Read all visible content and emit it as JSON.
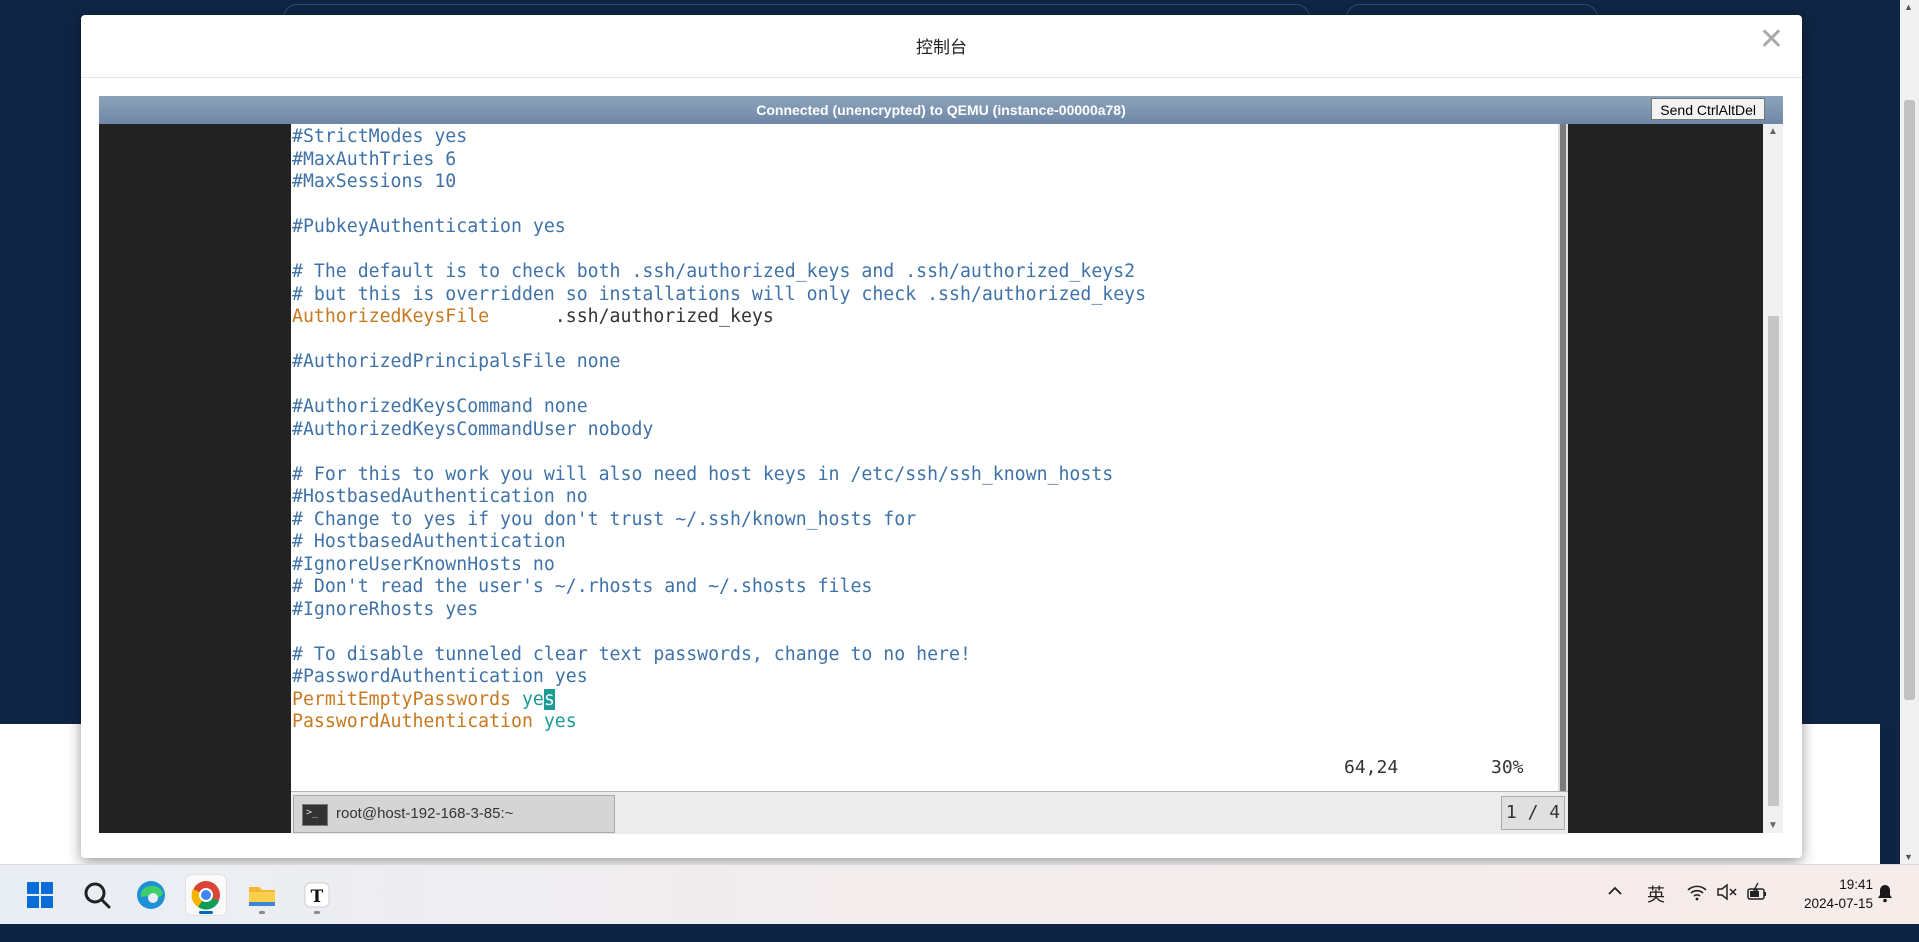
{
  "modal": {
    "title": "控制台",
    "close_glyph": "✕"
  },
  "vnc": {
    "status_text": "Connected (unencrypted) to QEMU (instance-00000a78)",
    "send_ctrl_alt_del_label": "Send CtrlAltDel"
  },
  "terminal": {
    "lines": [
      [
        {
          "t": "#StrictModes yes",
          "c": "comment"
        }
      ],
      [
        {
          "t": "#MaxAuthTries 6",
          "c": "comment"
        }
      ],
      [
        {
          "t": "#MaxSessions 10",
          "c": "comment"
        }
      ],
      [],
      [
        {
          "t": "#PubkeyAuthentication yes",
          "c": "comment"
        }
      ],
      [],
      [
        {
          "t": "# The default is to check both .ssh/authorized_keys and .ssh/authorized_keys2",
          "c": "comment"
        }
      ],
      [
        {
          "t": "# but this is overridden so installations will only check .ssh/authorized_keys",
          "c": "comment"
        }
      ],
      [
        {
          "t": "AuthorizedKeysFile",
          "c": "keyword"
        },
        {
          "t": "      .ssh/authorized_keys",
          "c": "plain"
        }
      ],
      [],
      [
        {
          "t": "#AuthorizedPrincipalsFile none",
          "c": "comment"
        }
      ],
      [],
      [
        {
          "t": "#AuthorizedKeysCommand none",
          "c": "comment"
        }
      ],
      [
        {
          "t": "#AuthorizedKeysCommandUser nobody",
          "c": "comment"
        }
      ],
      [],
      [
        {
          "t": "# For this to work you will also need host keys in /etc/ssh/ssh_known_hosts",
          "c": "comment"
        }
      ],
      [
        {
          "t": "#HostbasedAuthentication no",
          "c": "comment"
        }
      ],
      [
        {
          "t": "# Change to yes if you don't trust ~/.ssh/known_hosts for",
          "c": "comment"
        }
      ],
      [
        {
          "t": "# HostbasedAuthentication",
          "c": "comment"
        }
      ],
      [
        {
          "t": "#IgnoreUserKnownHosts no",
          "c": "comment"
        }
      ],
      [
        {
          "t": "# Don't read the user's ~/.rhosts and ~/.shosts files",
          "c": "comment"
        }
      ],
      [
        {
          "t": "#IgnoreRhosts yes",
          "c": "comment"
        }
      ],
      [],
      [
        {
          "t": "# To disable tunneled clear text passwords, change to no here!",
          "c": "comment"
        }
      ],
      [
        {
          "t": "#PasswordAuthentication yes",
          "c": "comment"
        }
      ],
      [
        {
          "t": "PermitEmptyPasswords",
          "c": "keyword"
        },
        {
          "t": " ye",
          "c": "value"
        },
        {
          "t": "s",
          "c": "cursor"
        }
      ],
      [
        {
          "t": "PasswordAuthentication",
          "c": "keyword"
        },
        {
          "t": " yes",
          "c": "value"
        }
      ]
    ],
    "cursor_position": "64,24",
    "scroll_percent": "30%"
  },
  "remote_taskbar": {
    "task_label": "root@host-192-168-3-85:~",
    "terminal_glyph": ">_",
    "pager": "1 / 4"
  },
  "host_taskbar": {
    "input_method": "英",
    "time": "19:41",
    "date": "2024-07-15",
    "app_icons": [
      "windows-start-icon",
      "search-icon",
      "edge-icon",
      "chrome-icon",
      "file-explorer-icon",
      "typora-icon"
    ]
  },
  "colors": {
    "comment": "#3e72a8",
    "keyword": "#c8781e",
    "value": "#1b9b95",
    "plain": "#333333",
    "background": "#0f2544"
  }
}
